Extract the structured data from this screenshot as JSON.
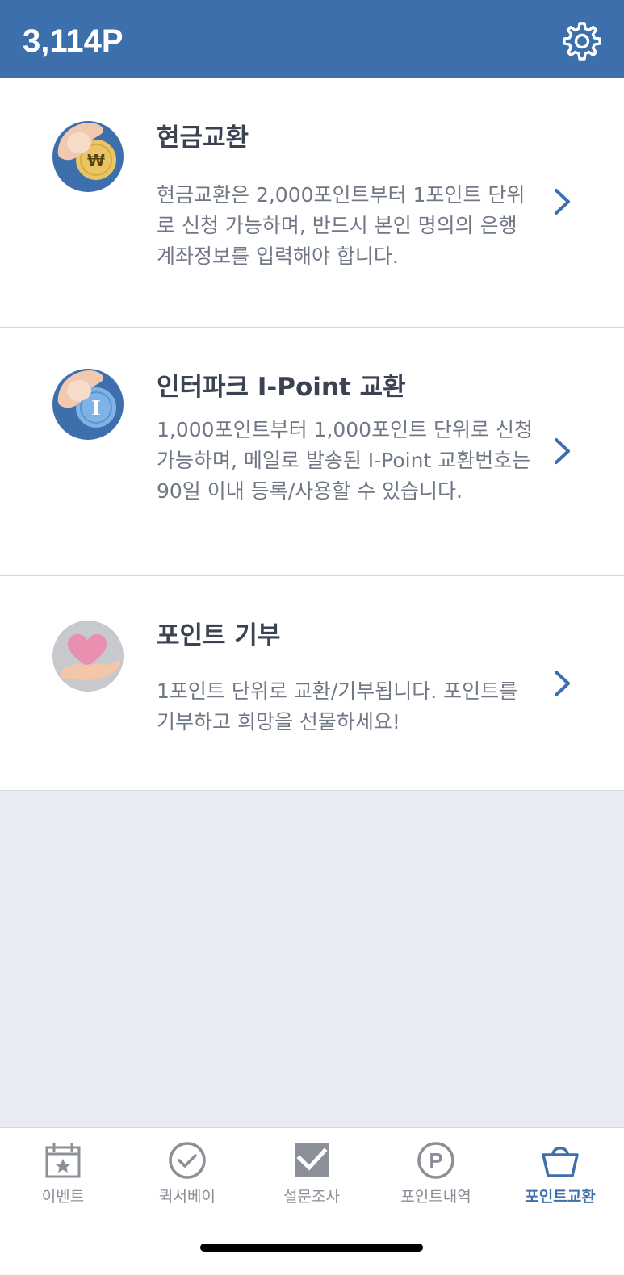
{
  "header": {
    "points": "3,114P",
    "settings_icon": "gear-icon",
    "color": "#3d6fad"
  },
  "items": [
    {
      "icon": "cash-coin-icon",
      "title": "현금교환",
      "description": "현금교환은 2,000포인트부터 1포인트 단위로 신청 가능하며, 반드시 본인 명의의 은행 계좌정보를 입력해야 합니다."
    },
    {
      "icon": "ipoint-coin-icon",
      "title": "인터파크 I-Point 교환",
      "description": "1,000포인트부터 1,000포인트 단위로 신청 가능하며, 메일로 발송된 I-Point 교환번호는 90일 이내 등록/사용할 수 있습니다."
    },
    {
      "icon": "heart-hand-icon",
      "title": "포인트 기부",
      "description": "1포인트 단위로 교환/기부됩니다. 포인트를 기부하고 희망을 선물하세요!"
    }
  ],
  "tabs": [
    {
      "label": "이벤트",
      "icon": "calendar-star-icon",
      "active": false
    },
    {
      "label": "퀵서베이",
      "icon": "check-circle-icon",
      "active": false
    },
    {
      "label": "설문조사",
      "icon": "survey-check-icon",
      "active": false
    },
    {
      "label": "포인트내역",
      "icon": "p-circle-icon",
      "active": false
    },
    {
      "label": "포인트교환",
      "icon": "basket-icon",
      "active": true
    }
  ]
}
